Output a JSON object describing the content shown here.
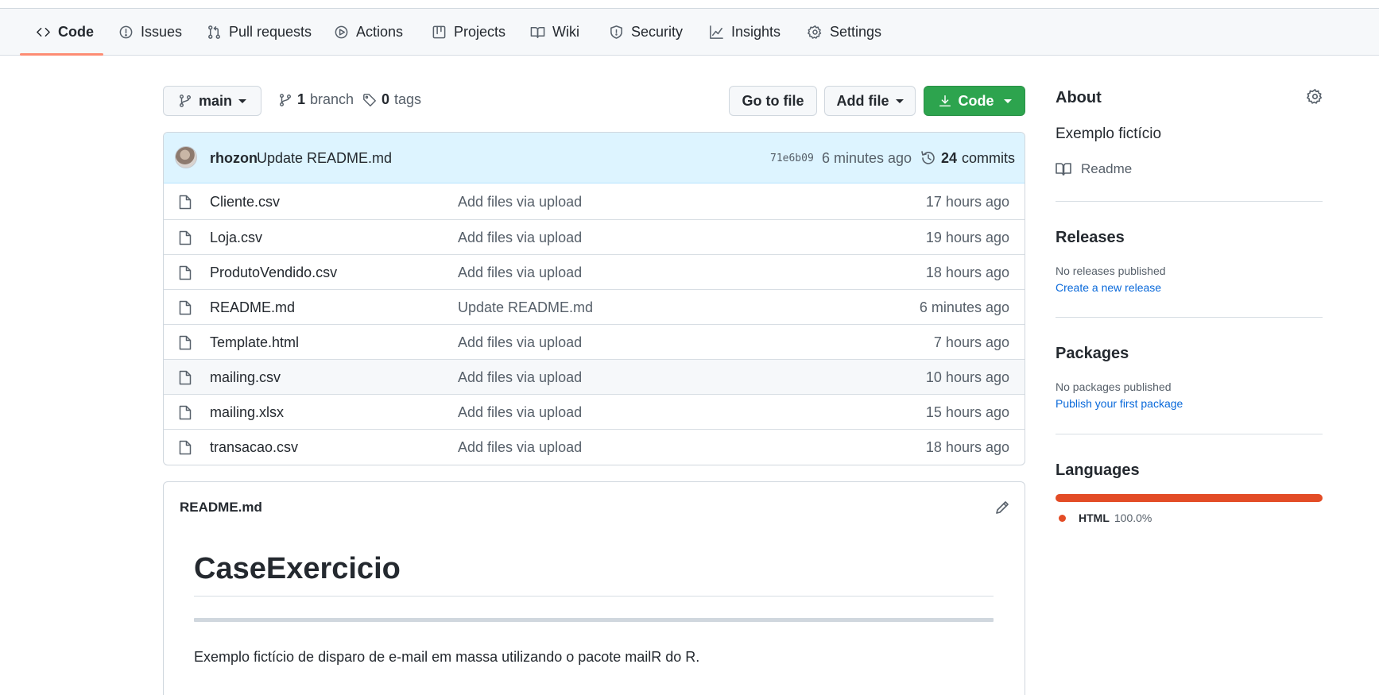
{
  "nav": {
    "tabs": [
      {
        "label": "Code",
        "icon": "code-icon",
        "active": true
      },
      {
        "label": "Issues",
        "icon": "issue-opened-icon"
      },
      {
        "label": "Pull requests",
        "icon": "git-pull-request-icon"
      },
      {
        "label": "Actions",
        "icon": "play-icon"
      },
      {
        "label": "Projects",
        "icon": "table-icon"
      },
      {
        "label": "Wiki",
        "icon": "book-icon"
      },
      {
        "label": "Security",
        "icon": "shield-icon"
      },
      {
        "label": "Insights",
        "icon": "graph-icon"
      },
      {
        "label": "Settings",
        "icon": "gear-icon"
      }
    ],
    "active_underline_color": "#fd8c73"
  },
  "toolbar": {
    "branch_label": "main",
    "branch_count": "1",
    "branch_word": "branch",
    "tag_count": "0",
    "tag_word": "tags",
    "go_to_file": "Go to file",
    "add_file": "Add file",
    "code_button": "Code",
    "code_button_color": "#2da44e"
  },
  "latest_commit": {
    "author": "rhozon",
    "message": "Update README.md",
    "sha": "71e6b09",
    "time": "6 minutes ago",
    "commit_count": "24",
    "commit_word": "commits"
  },
  "files": [
    {
      "name": "Cliente.csv",
      "message": "Add files via upload",
      "time": "17 hours ago"
    },
    {
      "name": "Loja.csv",
      "message": "Add files via upload",
      "time": "19 hours ago"
    },
    {
      "name": "ProdutoVendido.csv",
      "message": "Add files via upload",
      "time": "18 hours ago"
    },
    {
      "name": "README.md",
      "message": "Update README.md",
      "time": "6 minutes ago"
    },
    {
      "name": "Template.html",
      "message": "Add files via upload",
      "time": "7 hours ago"
    },
    {
      "name": "mailing.csv",
      "message": "Add files via upload",
      "time": "10 hours ago"
    },
    {
      "name": "mailing.xlsx",
      "message": "Add files via upload",
      "time": "15 hours ago"
    },
    {
      "name": "transacao.csv",
      "message": "Add files via upload",
      "time": "18 hours ago"
    }
  ],
  "readme": {
    "filename": "README.md",
    "heading": "CaseExercicio",
    "paragraph": "Exemplo fictício de disparo de e-mail em massa utilizando o pacote mailR do R."
  },
  "sidebar": {
    "about_title": "About",
    "about_description": "Exemplo fictício",
    "readme_link": "Readme",
    "releases_title": "Releases",
    "releases_empty": "No releases published",
    "releases_link": "Create a new release",
    "packages_title": "Packages",
    "packages_empty": "No packages published",
    "packages_link": "Publish your first package",
    "languages_title": "Languages",
    "languages": [
      {
        "name": "HTML",
        "percent": "100.0%",
        "color": "#e34c26"
      }
    ]
  }
}
